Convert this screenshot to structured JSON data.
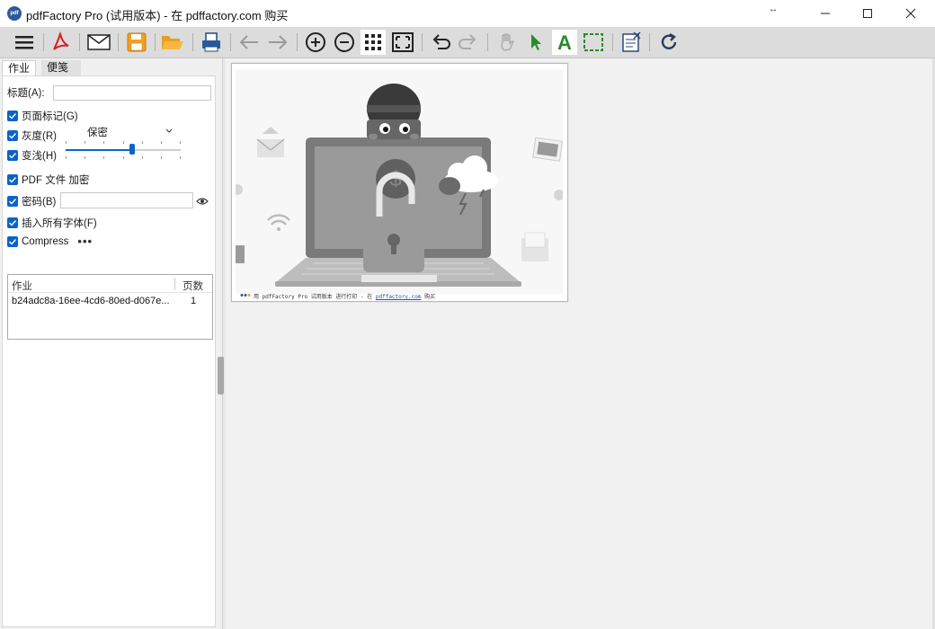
{
  "window": {
    "title": "pdfFactory Pro (试用版本) - 在 pdffactory.com 购买",
    "icon_label": "pdf",
    "controls": [
      "minimize",
      "maximize",
      "close"
    ]
  },
  "toolbar": {
    "buttons": [
      {
        "name": "menu",
        "icon": "hamburger-icon"
      },
      {
        "name": "save-pdf",
        "icon": "acrobat-icon"
      },
      {
        "name": "email",
        "icon": "envelope-icon"
      },
      {
        "name": "save",
        "icon": "floppy-disk-icon"
      },
      {
        "name": "open",
        "icon": "folder-open-icon"
      },
      {
        "name": "print",
        "icon": "printer-icon"
      },
      {
        "name": "back",
        "icon": "arrow-left-icon"
      },
      {
        "name": "forward",
        "icon": "arrow-right-icon"
      },
      {
        "name": "zoom-in",
        "icon": "zoom-in-icon"
      },
      {
        "name": "zoom-out",
        "icon": "zoom-out-icon"
      },
      {
        "name": "thumbnails",
        "icon": "grid-icon"
      },
      {
        "name": "fit-page",
        "icon": "fit-page-icon"
      },
      {
        "name": "undo",
        "icon": "undo-icon"
      },
      {
        "name": "redo",
        "icon": "redo-icon"
      },
      {
        "name": "pan",
        "icon": "hand-icon"
      },
      {
        "name": "select",
        "icon": "cursor-icon"
      },
      {
        "name": "text",
        "icon": "text-a-icon"
      },
      {
        "name": "marquee",
        "icon": "marquee-select-icon"
      },
      {
        "name": "page-notes",
        "icon": "notes-icon"
      },
      {
        "name": "refresh",
        "icon": "refresh-icon"
      }
    ]
  },
  "tabs": {
    "job": "作业",
    "notes": "便笺"
  },
  "form": {
    "title_label": "标题(A):",
    "title_value": "",
    "page_mark_label": "页面标记(G)",
    "page_mark_value": "保密",
    "grayscale_label": "灰度(R)",
    "lighten_label": "变浅(H)",
    "lighten_level": 0.58,
    "encrypt_label": "PDF 文件 加密",
    "password_label": "密码(B)",
    "password_value": "",
    "embed_fonts_label": "插入所有字体(F)",
    "compress_label": "Compress",
    "more_label": "•••"
  },
  "jobs_table": {
    "headers": [
      "作业",
      "页数"
    ],
    "rows": [
      {
        "job": "b24adc8a-16ee-4cd6-80ed-d067e...",
        "pages": "1"
      }
    ]
  },
  "preview": {
    "footer_prefix": "用 pdfFactory Pro 试用版本 进行打印 - 在",
    "footer_link": "pdffactory.com",
    "footer_suffix": "购买"
  },
  "colors": {
    "accent": "#0a64c8",
    "toolbar_bg": "#dcdcdc",
    "preview_bg": "#f1f1f1",
    "acrobat_red": "#d42020",
    "folder_orange": "#e8a020",
    "select_green": "#2a8a2a"
  }
}
